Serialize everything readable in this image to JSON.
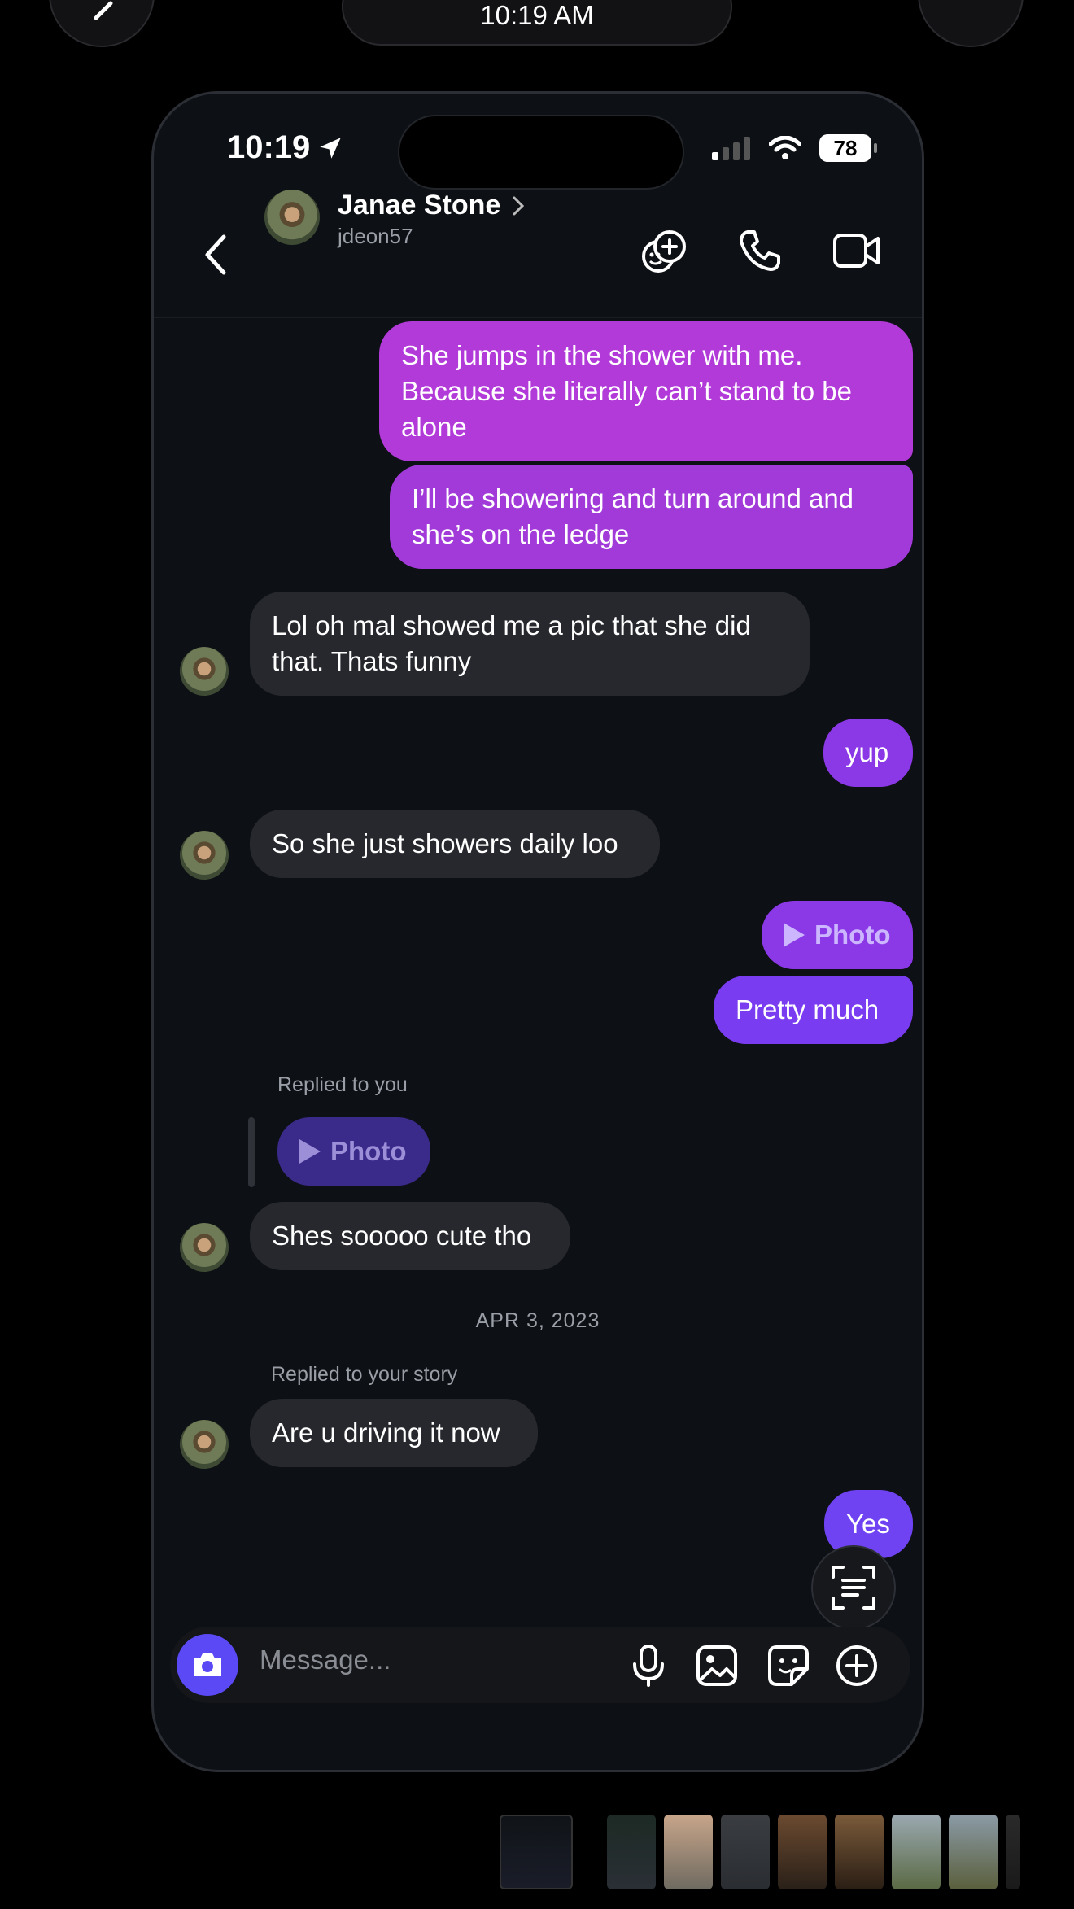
{
  "top_bar": {
    "time": "10:19 AM"
  },
  "status_bar": {
    "time": "10:19",
    "battery": "78"
  },
  "header": {
    "name": "Janae Stone",
    "username": "jdeon57"
  },
  "messages": {
    "m1": "She jumps in the shower with me. Because she literally can’t stand to be alone",
    "m2": "I’ll be showering and turn around and she’s on the ledge",
    "m3": "Lol oh mal showed me a pic that she did that. Thats funny",
    "m4": "yup",
    "m5": "So she just showers daily loo",
    "m6_label": "Photo",
    "m7": "Pretty much",
    "reply_meta": "Replied to you",
    "reply_photo_label": "Photo",
    "m8": "Shes sooooo cute tho",
    "date_divider": "APR 3, 2023",
    "story_meta": "Replied to your story",
    "m9": "Are u driving it now",
    "m10": "Yes"
  },
  "composer": {
    "placeholder": "Message..."
  },
  "colors": {
    "outgoing_pink": "#b23ad9",
    "outgoing_purple": "#7a3cf0",
    "incoming": "#26282d",
    "camera": "#5a49f5"
  }
}
